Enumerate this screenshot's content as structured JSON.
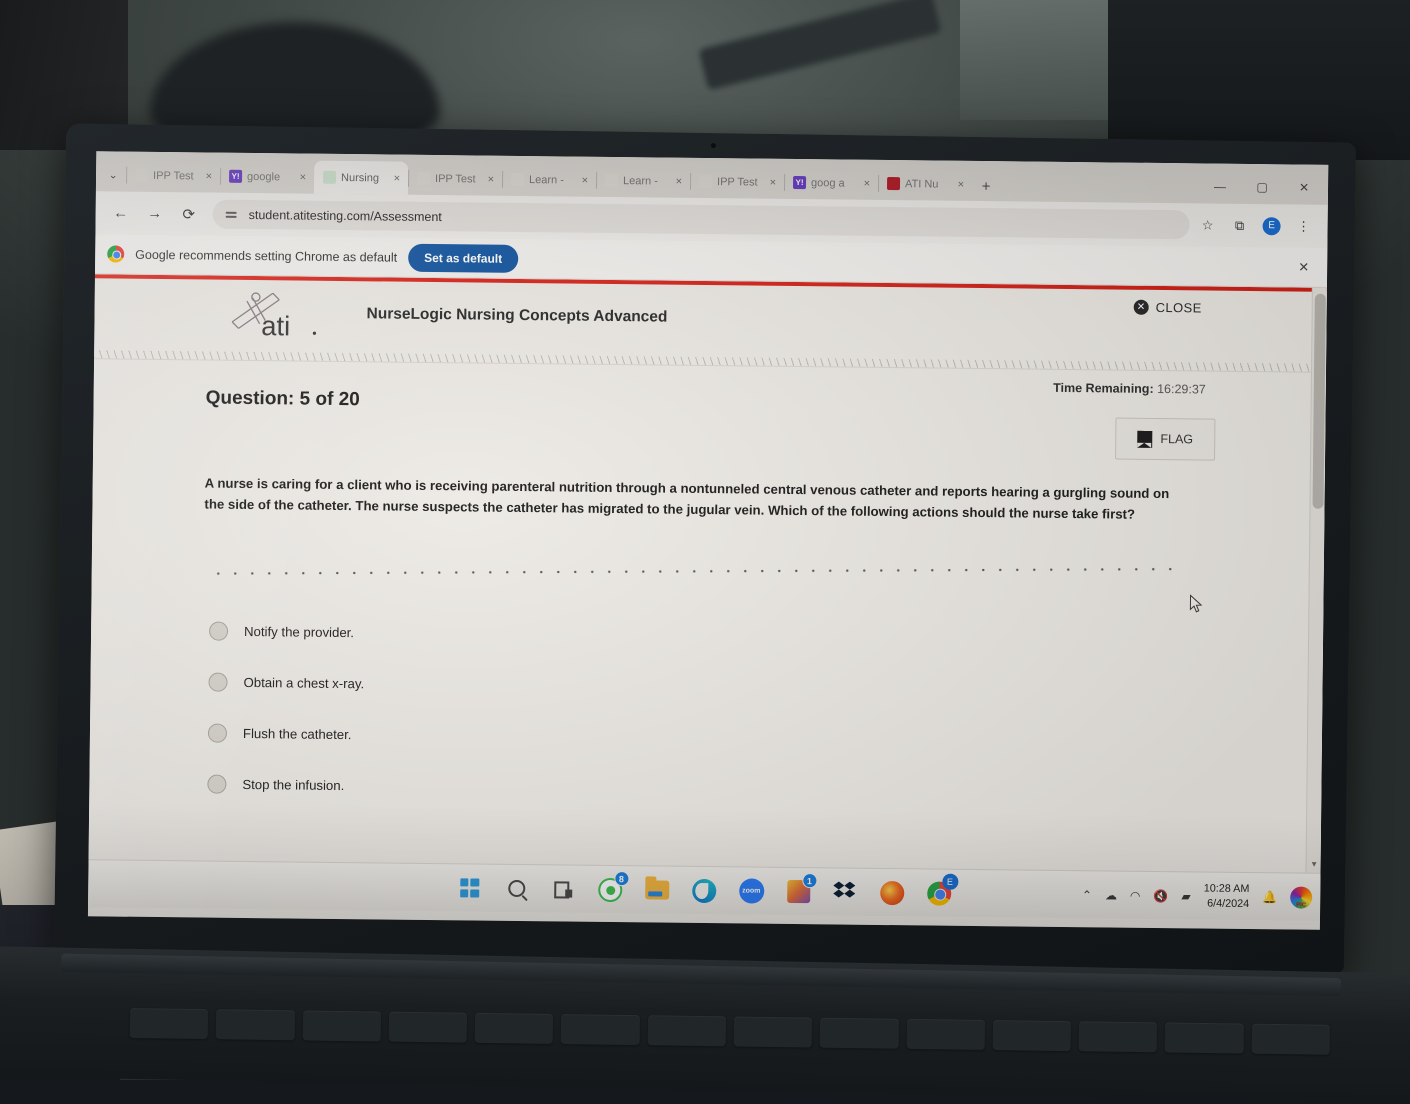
{
  "browser": {
    "tabs": [
      {
        "title": "IPP Test",
        "favicon": "doc-icon",
        "active": false
      },
      {
        "title": "google",
        "favicon": "yahoo-icon",
        "active": false
      },
      {
        "title": "Nursing",
        "favicon": "nursing-icon",
        "active": true
      },
      {
        "title": "IPP Test",
        "favicon": "doc-icon",
        "active": false
      },
      {
        "title": "Learn -",
        "favicon": "doc-icon",
        "active": false
      },
      {
        "title": "Learn -",
        "favicon": "doc-icon",
        "active": false
      },
      {
        "title": "IPP Test",
        "favicon": "doc-icon",
        "active": false
      },
      {
        "title": "goog a",
        "favicon": "yahoo-icon",
        "active": false
      },
      {
        "title": "ATI Nu",
        "favicon": "ati-icon",
        "active": false
      }
    ],
    "tab_close_label": "×",
    "new_tab_label": "+",
    "tab_list_chevron": "⌄",
    "window_minimize": "—",
    "window_maximize": "▢",
    "window_close": "✕",
    "nav": {
      "back": "←",
      "forward": "→",
      "reload": "⟳"
    },
    "url": "student.atitesting.com/Assessment",
    "bookmark_star": "☆",
    "extensions": "⧉",
    "profile_initial": "E",
    "menu": "⋮"
  },
  "infobar": {
    "message": "Google recommends setting Chrome as default",
    "button_label": "Set as default",
    "dismiss_label": "✕"
  },
  "assessment": {
    "brand": "ati",
    "title": "NurseLogic Nursing Concepts Advanced",
    "close_label": "CLOSE",
    "close_icon_glyph": "✕",
    "time_remaining_label": "Time Remaining:",
    "time_remaining_value": "16:29:37",
    "question_counter": "Question: 5 of 20",
    "flag_label": "FLAG",
    "question_text": "A nurse is caring for a client who is receiving parenteral nutrition through a nontunneled central venous catheter and reports hearing a gurgling sound on the side of the catheter. The nurse suspects the catheter has migrated to the jugular vein. Which of the following actions should the nurse take first?",
    "options": [
      {
        "label": "Notify the provider.",
        "selected": false
      },
      {
        "label": "Obtain a chest x-ray.",
        "selected": false
      },
      {
        "label": "Flush the catheter.",
        "selected": false
      },
      {
        "label": "Stop the infusion.",
        "selected": false
      }
    ],
    "scroll_down_arrow": "▼",
    "accent_red": "#d8261c",
    "accent_teal": "#62c5c7"
  },
  "taskbar": {
    "icons": [
      {
        "name": "windows-start-icon",
        "badge": ""
      },
      {
        "name": "search-icon",
        "badge": ""
      },
      {
        "name": "task-view-icon",
        "badge": ""
      },
      {
        "name": "whatsapp-icon",
        "badge": "8"
      },
      {
        "name": "file-explorer-icon",
        "badge": ""
      },
      {
        "name": "edge-icon",
        "badge": ""
      },
      {
        "name": "zoom-icon",
        "badge": "",
        "label": "zoom"
      },
      {
        "name": "microsoft-store-icon",
        "badge": "1"
      },
      {
        "name": "dropbox-icon",
        "badge": ""
      },
      {
        "name": "firefox-icon",
        "badge": ""
      },
      {
        "name": "chrome-icon",
        "badge": "E"
      }
    ],
    "tray": {
      "overflow_chevron": "⌃",
      "onedrive_icon": "☁",
      "wifi_icon": "◠",
      "volume_icon": "🔇",
      "battery_icon": "▰",
      "time": "10:28 AM",
      "date": "6/4/2024",
      "notification_icon": "🔔",
      "photos_icon": "PIC"
    }
  }
}
